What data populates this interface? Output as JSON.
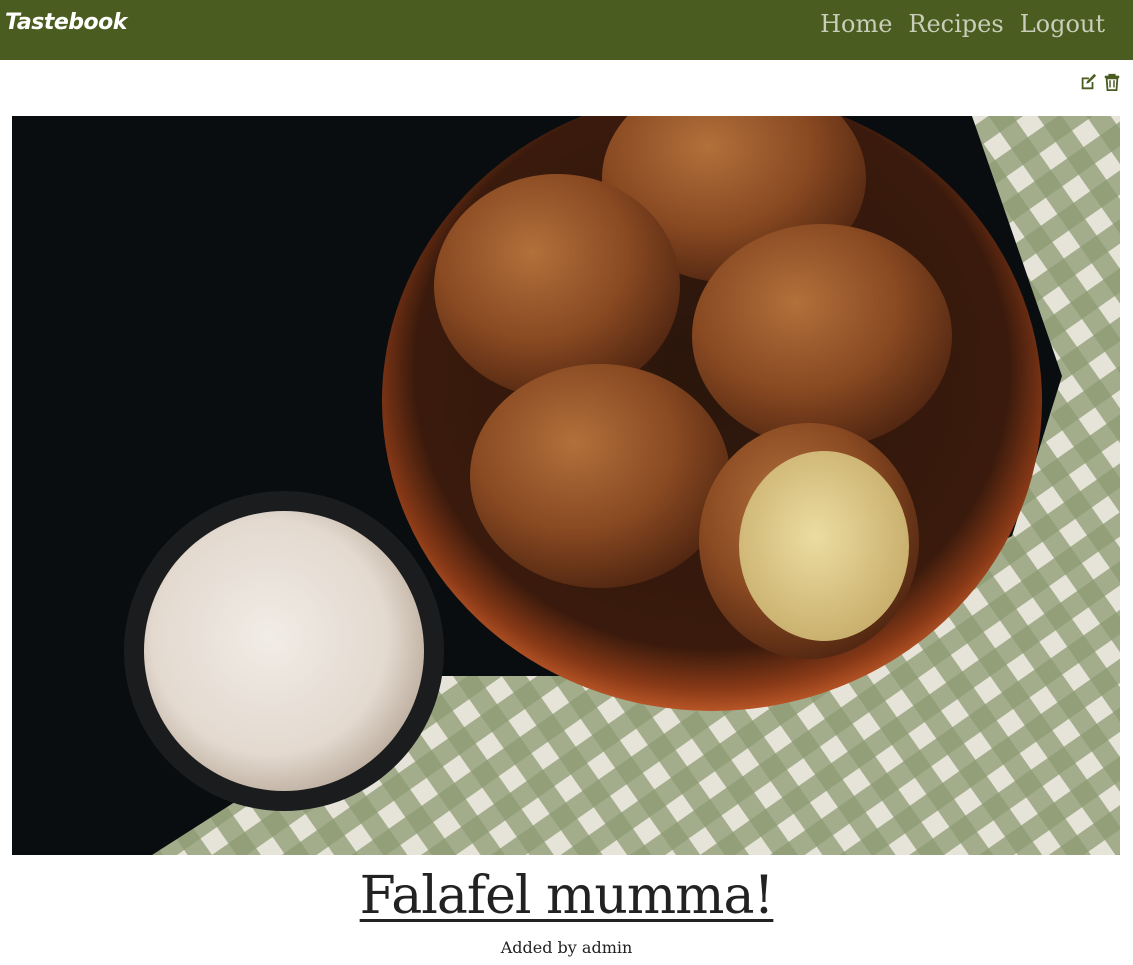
{
  "navbar": {
    "brand": "Tastebook",
    "links": [
      {
        "label": "Home"
      },
      {
        "label": "Recipes"
      },
      {
        "label": "Logout"
      }
    ],
    "background": "#4a5c1f"
  },
  "actions": {
    "edit_icon": "edit-icon",
    "delete_icon": "trash-icon",
    "color": "#4a5c1f"
  },
  "recipe": {
    "title": "Falafel mumma!",
    "added_by_prefix": "Added by",
    "author": "admin"
  }
}
